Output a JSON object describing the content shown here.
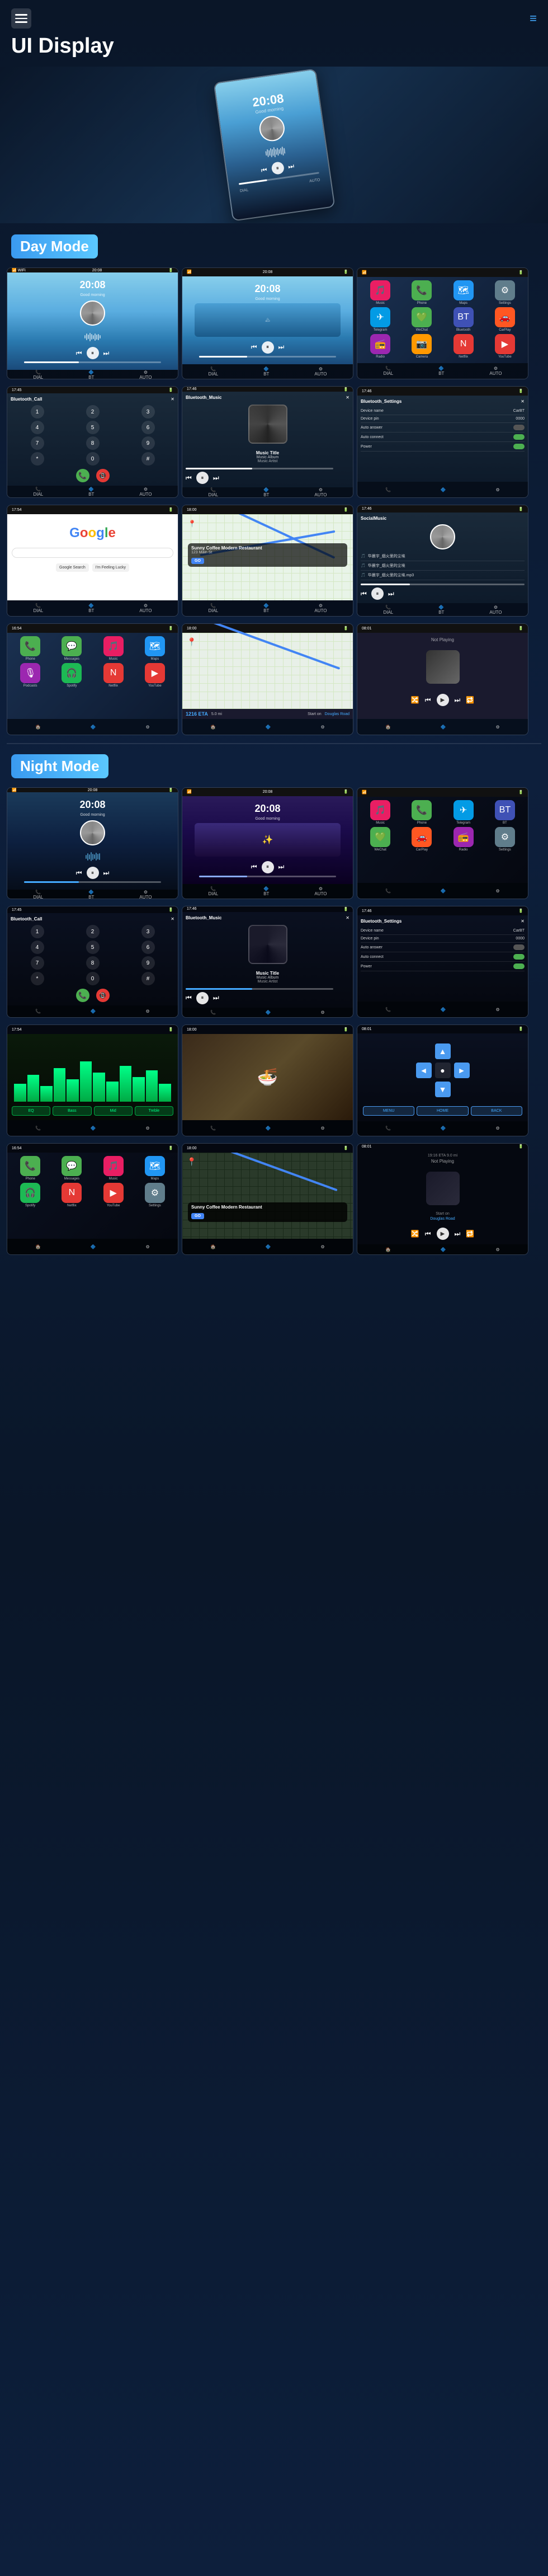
{
  "header": {
    "hamburger_label": "menu",
    "title": "UI Display",
    "menu_icon": "≡"
  },
  "day_mode": {
    "label": "Day Mode",
    "screens": [
      {
        "type": "music_player",
        "time": "20:08",
        "subtitle": "Good morning",
        "has_art": true
      },
      {
        "type": "music_player",
        "time": "20:08",
        "subtitle": "Good morning",
        "has_art": false
      },
      {
        "type": "app_grid"
      },
      {
        "type": "bt_call",
        "title": "Bluetooth_Call"
      },
      {
        "type": "bt_music",
        "title": "Bluetooth_Music",
        "track_title": "Music Title",
        "track_album": "Music Album",
        "track_artist": "Music Artist"
      },
      {
        "type": "bt_settings",
        "title": "Bluetooth_Settings"
      },
      {
        "type": "google"
      },
      {
        "type": "maps"
      },
      {
        "type": "social_music",
        "title": "SocialMusic"
      }
    ]
  },
  "carplay_row": {
    "screens": [
      {
        "type": "carplay_home"
      },
      {
        "type": "carplay_maps_nav"
      },
      {
        "type": "now_playing_dark"
      }
    ]
  },
  "night_mode": {
    "label": "Night Mode",
    "screens": [
      {
        "type": "music_night",
        "time": "20:08",
        "subtitle": "Good morning"
      },
      {
        "type": "music_night2",
        "time": "20:08",
        "subtitle": "Good morning"
      },
      {
        "type": "app_grid_night"
      },
      {
        "type": "bt_call_night",
        "title": "Bluetooth_Call"
      },
      {
        "type": "bt_music_night",
        "title": "Bluetooth_Music",
        "track_title": "Music Title",
        "track_album": "Music Album",
        "track_artist": "Music Artist"
      },
      {
        "type": "bt_settings_night",
        "title": "Bluetooth_Settings"
      },
      {
        "type": "green_viz"
      },
      {
        "type": "food_photo"
      },
      {
        "type": "nav_arrows_screen"
      }
    ]
  },
  "carplay_row_night": {
    "screens": [
      {
        "type": "carplay_home_night"
      },
      {
        "type": "carplay_maps_night"
      },
      {
        "type": "now_playing_night"
      }
    ]
  },
  "controls": {
    "prev": "⏮",
    "play": "⏸",
    "next": "⏭",
    "pause": "⏸",
    "rewind": "⏪",
    "forward": "⏩"
  },
  "app_icons": {
    "phone": "📞",
    "messages": "💬",
    "music": "🎵",
    "maps": "🗺",
    "settings": "⚙",
    "bt": "🔷",
    "wechat": "💚",
    "telegram": "✈",
    "radio": "📻",
    "camera": "📷",
    "netflix": "🎬",
    "youtube": "▶"
  },
  "go_label": "GO",
  "not_playing": "Not Playing",
  "start_label": "Start on",
  "douglas_road": "Douglas Road",
  "address_label": "1216 ETA",
  "distance_label": "5.0 mi",
  "device_name_label": "Device name",
  "device_pin_label": "Device pin",
  "auto_answer_label": "Auto answer",
  "auto_connect_label": "Auto connect",
  "power_label": "Power",
  "device_name_val": "CarBT",
  "device_pin_val": "0000",
  "sunny_coffee": "Sunny Coffee Modern Restaurant",
  "music_title": "Music Title",
  "music_album": "Music Album",
  "music_artist": "Music Artist"
}
